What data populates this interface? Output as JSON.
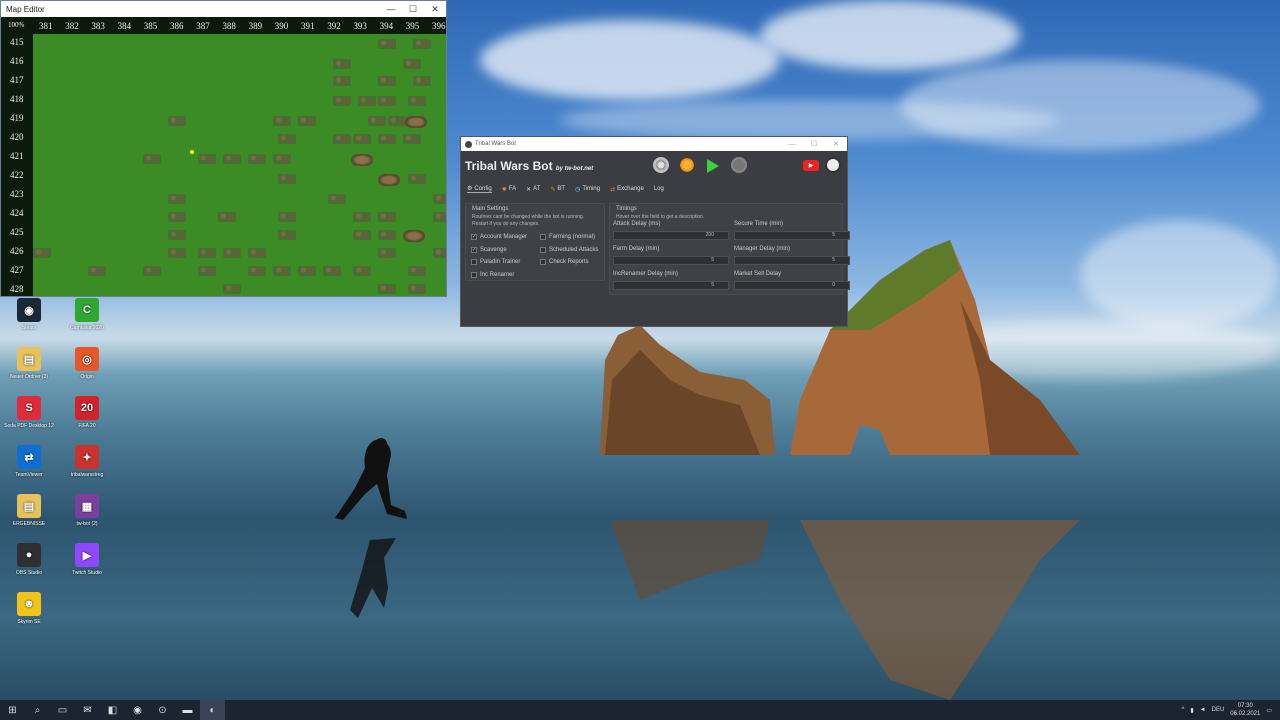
{
  "map_editor": {
    "title": "Map Editor",
    "zoom": "100%",
    "columns": [
      "381",
      "382",
      "383",
      "384",
      "385",
      "386",
      "387",
      "388",
      "389",
      "390",
      "391",
      "392",
      "393",
      "394",
      "395",
      "396"
    ],
    "rows": [
      "415",
      "416",
      "417",
      "418",
      "419",
      "420",
      "421",
      "422",
      "423",
      "424",
      "425",
      "426",
      "427",
      "428"
    ],
    "win_min": "—",
    "win_max": "☐",
    "win_close": "✕"
  },
  "bot": {
    "window_title": "Tribal Wars Bot",
    "brand": "Tribal Wars Bot",
    "brand_by": "by tw-bot.net",
    "tabs": [
      "Config",
      "FA",
      "AT",
      "BT",
      "Timing",
      "Exchange",
      "Log"
    ],
    "main_settings": {
      "title": "Main Settings",
      "note1": "Routines cant be changed while the bot is running.",
      "note2": "Restart if you do any changes.",
      "options_left": [
        {
          "label": "Account Manager",
          "checked": true
        },
        {
          "label": "Scavenge",
          "checked": true
        },
        {
          "label": "Paladin Trainer",
          "checked": false
        },
        {
          "label": "Inc Renamer",
          "checked": false
        }
      ],
      "options_right": [
        {
          "label": "Farming (normal)",
          "checked": false
        },
        {
          "label": "Scheduled Attacks",
          "checked": false
        },
        {
          "label": "Check Reports",
          "checked": false
        }
      ]
    },
    "timings": {
      "title": "Timings",
      "hint": "Hover over the field to get a description.",
      "fields": [
        {
          "label": "Attack Delay (ms)",
          "value": "200"
        },
        {
          "label": "Secure Time (min)",
          "value": "5"
        },
        {
          "label": "Farm Delay (min)",
          "value": "5"
        },
        {
          "label": "Manager Delay (min)",
          "value": "5"
        },
        {
          "label": "IncRenamer Delay (min)",
          "value": "5"
        },
        {
          "label": "Market Sell Delay",
          "value": "0"
        }
      ]
    }
  },
  "desktop_icons": [
    {
      "label": "Steam",
      "glyph": "◉",
      "color": "#1b2838"
    },
    {
      "label": "Camtasia 2020",
      "glyph": "C",
      "color": "#2fa832"
    },
    {
      "label": "Neuer Ordner (3)",
      "glyph": "▤",
      "color": "#e8c15a"
    },
    {
      "label": "Origin",
      "glyph": "◎",
      "color": "#e6582a"
    },
    {
      "label": "Soda PDF Desktop 12",
      "glyph": "S",
      "color": "#e02b3a"
    },
    {
      "label": "FIFA 20",
      "glyph": "20",
      "color": "#d2232a"
    },
    {
      "label": "TeamViewer",
      "glyph": "⇄",
      "color": "#0e6fd1"
    },
    {
      "label": "tribalwarsstreg",
      "glyph": "✦",
      "color": "#c9322e"
    },
    {
      "label": "ERGEBNISSE",
      "glyph": "▤",
      "color": "#e8c15a"
    },
    {
      "label": "tw-bot (2)",
      "glyph": "▦",
      "color": "#7b3fa0"
    },
    {
      "label": "OBS Studio",
      "glyph": "●",
      "color": "#302e31"
    },
    {
      "label": "Twitch Studio",
      "glyph": "▶",
      "color": "#9146ff"
    },
    {
      "label": "Skyrim SE",
      "glyph": "☻",
      "color": "#f0c419"
    }
  ],
  "taskbar": {
    "start": "⊞",
    "search": "⌕",
    "apps": [
      "▭",
      "✉",
      "◧",
      "◉",
      "⊙",
      "▬",
      "◐"
    ],
    "tray_up": "^",
    "lang": "DEU",
    "time": "07:30",
    "date": "06.02.2021"
  }
}
